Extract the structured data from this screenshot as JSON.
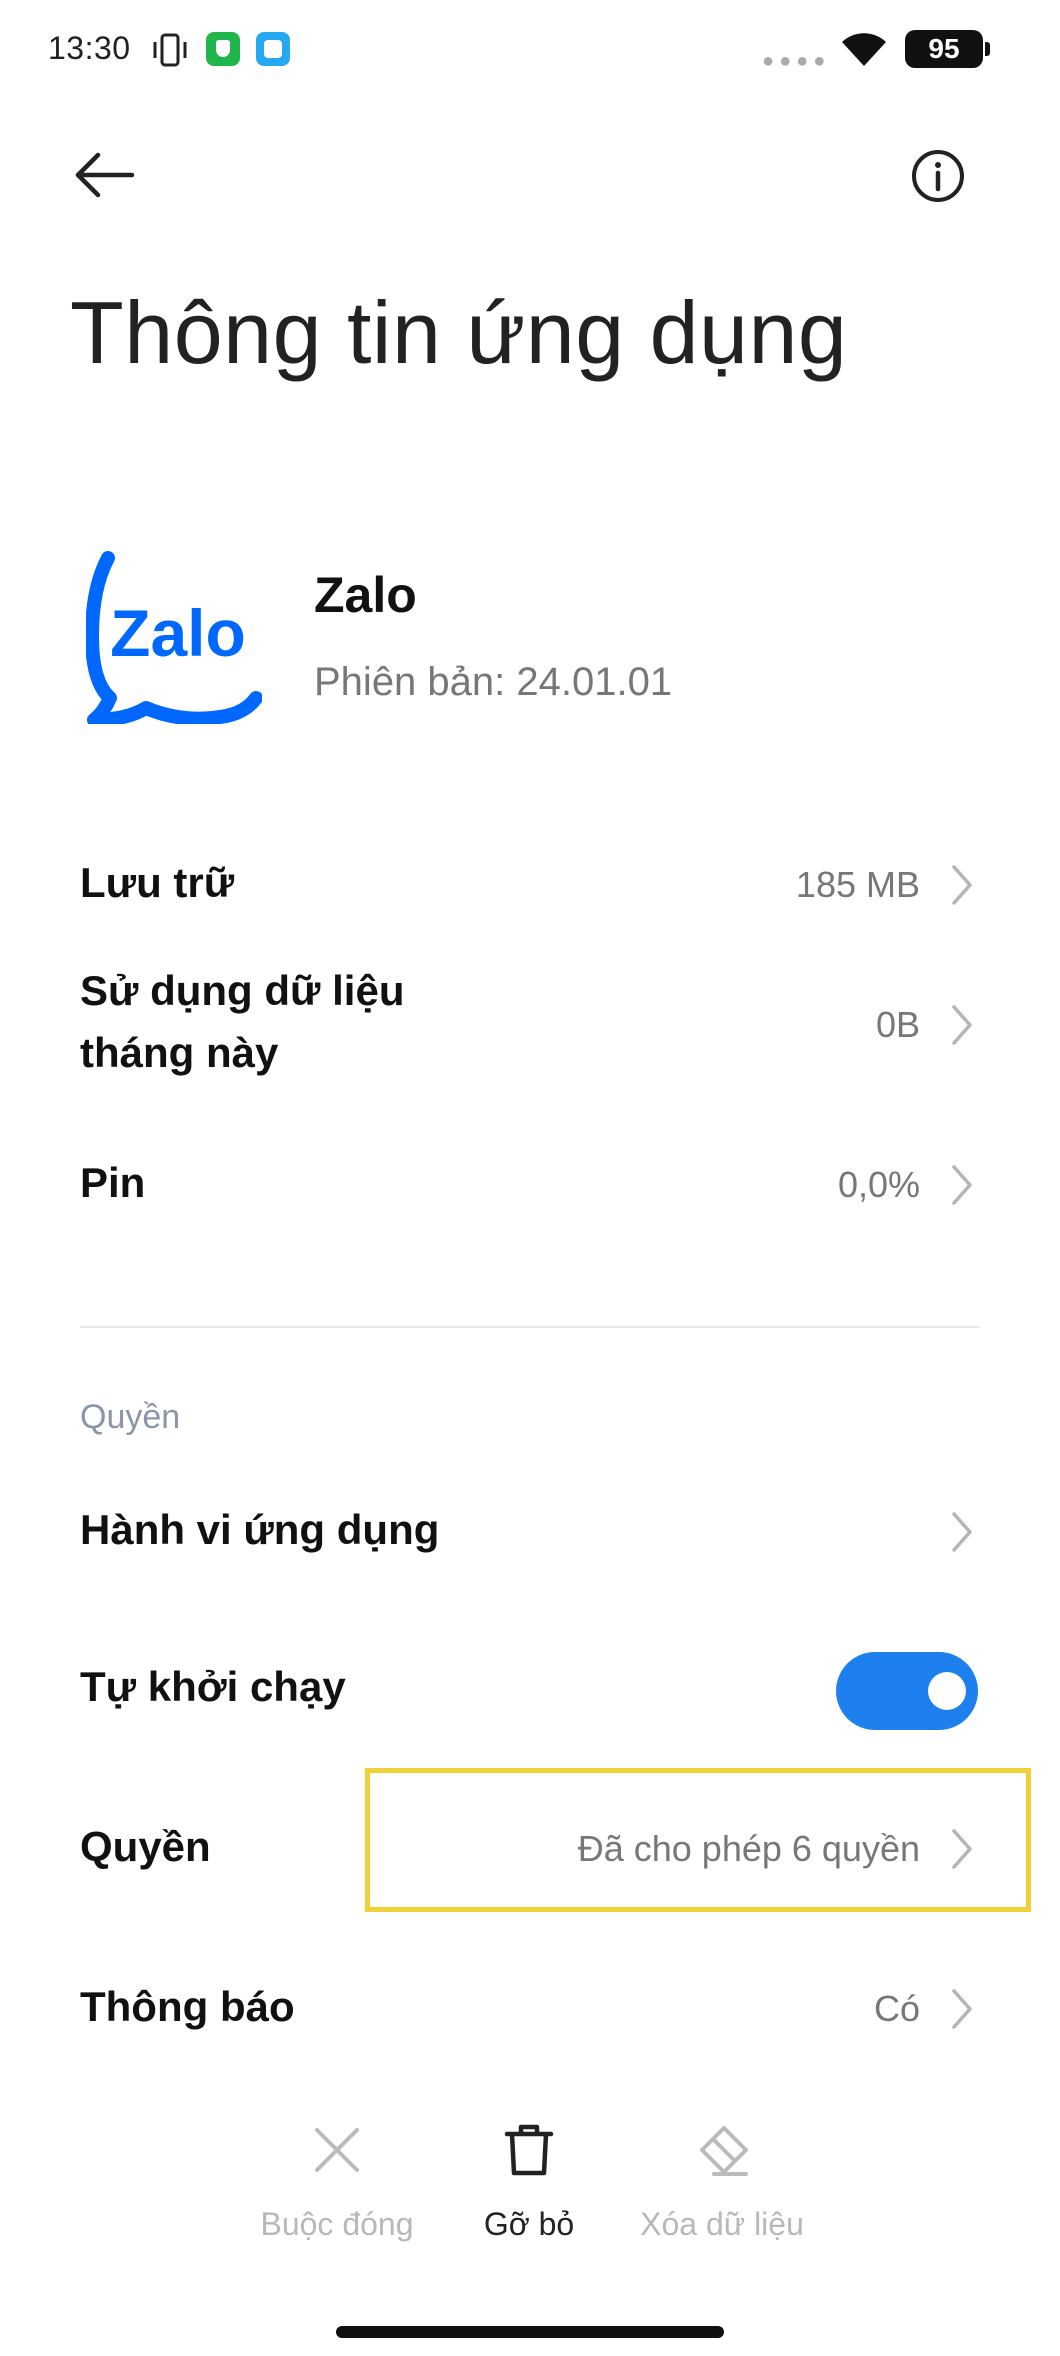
{
  "status_bar": {
    "time": "13:30",
    "battery": "95",
    "icons": [
      "vibrate-icon",
      "shield-notification-icon",
      "app-notification-icon",
      "signal-dots-icon",
      "wifi-icon",
      "battery-icon"
    ]
  },
  "header": {
    "back_icon": "arrow-left-icon",
    "info_icon": "info-circle-icon",
    "title": "Thông tin ứng dụng"
  },
  "app": {
    "name": "Zalo",
    "version": "Phiên bản: 24.01.01",
    "logo_text": "Zalo",
    "brand_color": "#0068ff"
  },
  "usage_rows": [
    {
      "label": "Lưu trữ",
      "value": "185 MB"
    },
    {
      "label_line1": "Sử dụng dữ liệu",
      "label_line2": "tháng này",
      "value": "0B"
    },
    {
      "label": "Pin",
      "value": "0,0%"
    }
  ],
  "permissions_section": {
    "title": "Quyền",
    "rows": [
      {
        "label": "Hành vi ứng dụng",
        "value": ""
      },
      {
        "label": "Tự khởi chạy",
        "toggle": true
      },
      {
        "label": "Quyền",
        "value": "Đã cho phép 6 quyền",
        "highlighted": true
      },
      {
        "label": "Thông báo",
        "value": "Có"
      }
    ]
  },
  "actions": [
    {
      "label": "Buộc đóng",
      "icon": "close-x-icon",
      "enabled": false
    },
    {
      "label": "Gỡ bỏ",
      "icon": "trash-icon",
      "enabled": true
    },
    {
      "label": "Xóa dữ liệu",
      "icon": "eraser-icon",
      "enabled": false
    }
  ],
  "colors": {
    "toggle_on": "#1e80ee",
    "highlight": "#f1cf37",
    "section_title": "#8a96a8"
  }
}
